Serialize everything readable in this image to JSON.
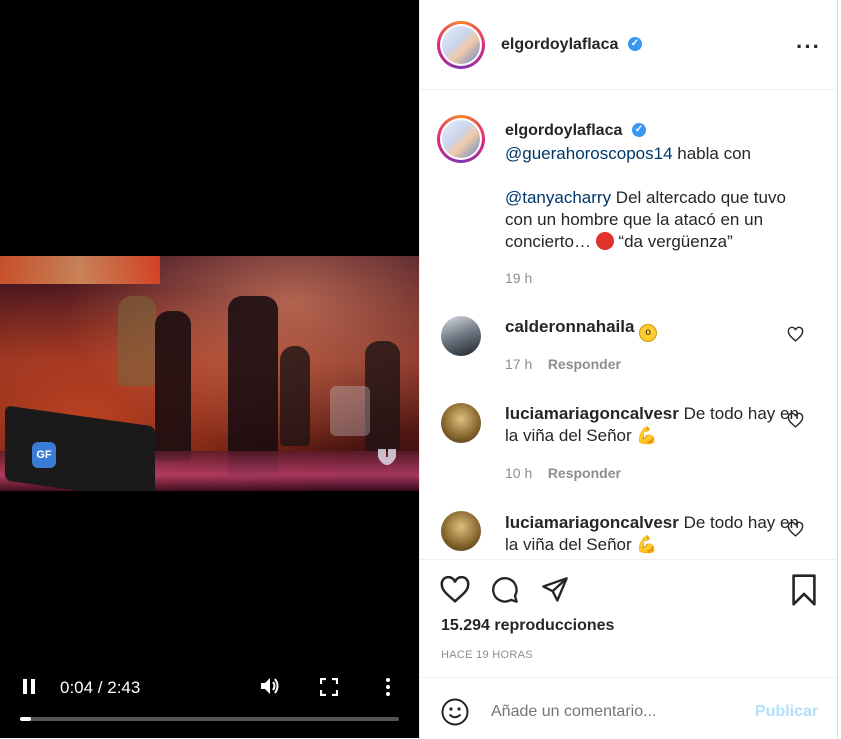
{
  "player": {
    "time": "0:04 / 2:43",
    "progress_fraction": 0.03,
    "watermark_left": "GF",
    "icons": [
      "pause-icon",
      "volume-icon",
      "fullscreen-icon",
      "more-vertical-icon"
    ]
  },
  "post": {
    "username": "elgordoylaflaca",
    "caption_mention_1": "@guerahoroscopos14",
    "caption_part_1": " habla con",
    "caption_mention_2": "@tanyacharry",
    "caption_part_2": " Del altercado que tuvo con un hombre que la atacó en un concierto… ",
    "caption_part_3": " “da vergüenza”",
    "caption_time": "19 h"
  },
  "comments": [
    {
      "username": "calderonnahaila",
      "text": "",
      "time": "17 h",
      "reply": "Responder"
    },
    {
      "username": "luciamariagoncalvesr",
      "text": " De todo hay en la viña del Señor ",
      "time": "10 h",
      "reply": "Responder"
    },
    {
      "username": "luciamariagoncalvesr",
      "text": " De todo hay en la viña del Señor "
    }
  ],
  "stats": {
    "views": "15.294 reproducciones",
    "ago": "HACE 19 HORAS"
  },
  "comment_box": {
    "placeholder": "Añade un comentario...",
    "publish": "Publicar"
  },
  "colors": {
    "link": "#00376b",
    "verified": "#3897f0",
    "publish_disabled": "#b2dffc"
  }
}
